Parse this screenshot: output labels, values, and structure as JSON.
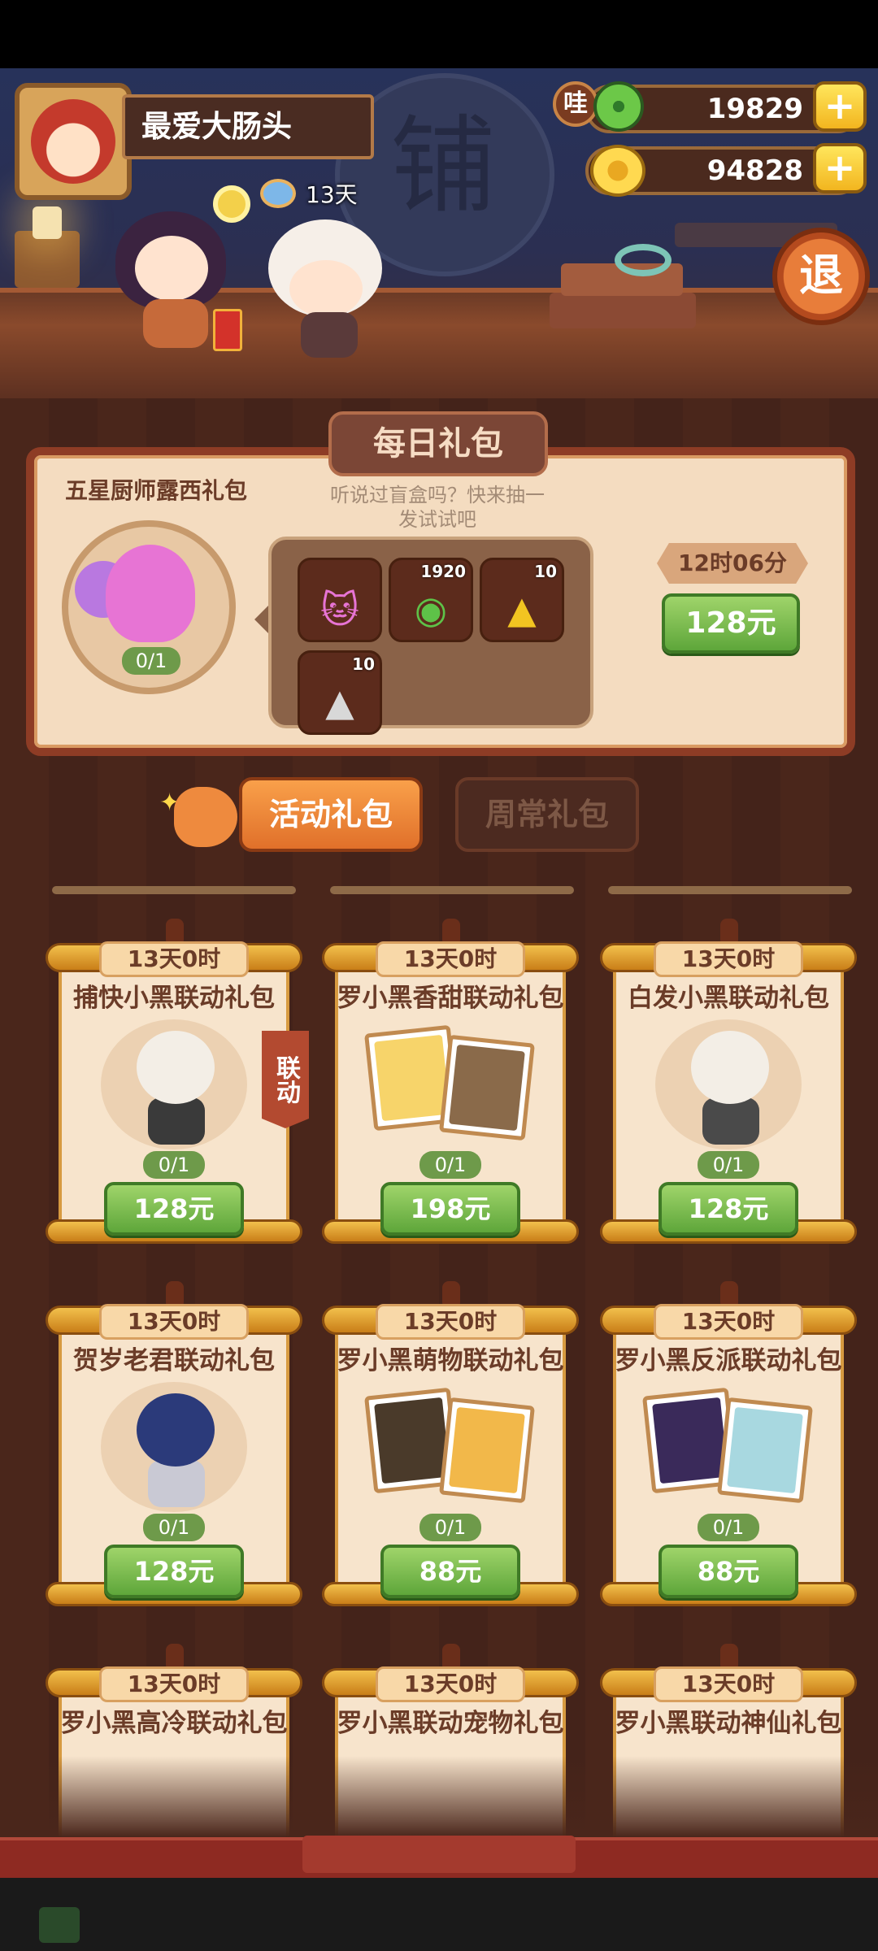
{
  "header": {
    "player_name": "最爱大肠头",
    "jade_amount": "19829",
    "coin_amount": "94828",
    "plus_label": "+",
    "wa_badge": "哇",
    "exit_label": "退",
    "days_left": "13天",
    "shop_sign": "铺"
  },
  "daily": {
    "title": "每日礼包",
    "pack_name": "五星厨师露西礼包",
    "hint": "听说过盲盒吗？快来抽一发试试吧",
    "count": "0/1",
    "timer": "12时06分",
    "price": "128元",
    "items": [
      {
        "icon": "pink-cat-icon",
        "num": ""
      },
      {
        "icon": "jade-coin-icon",
        "num": "1920"
      },
      {
        "icon": "gold-fragment-icon",
        "num": "10"
      },
      {
        "icon": "silver-fragment-icon",
        "num": "10"
      }
    ]
  },
  "tabs": {
    "active": "活动礼包",
    "inactive": "周常礼包"
  },
  "collab_tag": "联动",
  "cards": [
    {
      "time": "13天0时",
      "title": "捕快小黑联动礼包",
      "count": "0/1",
      "price": "128元"
    },
    {
      "time": "13天0时",
      "title": "罗小黑香甜联动礼包",
      "count": "0/1",
      "price": "198元"
    },
    {
      "time": "13天0时",
      "title": "白发小黑联动礼包",
      "count": "0/1",
      "price": "128元"
    },
    {
      "time": "13天0时",
      "title": "贺岁老君联动礼包",
      "count": "0/1",
      "price": "128元"
    },
    {
      "time": "13天0时",
      "title": "罗小黑萌物联动礼包",
      "count": "0/1",
      "price": "88元"
    },
    {
      "time": "13天0时",
      "title": "罗小黑反派联动礼包",
      "count": "0/1",
      "price": "88元"
    },
    {
      "time": "13天0时",
      "title": "罗小黑高冷联动礼包"
    },
    {
      "time": "13天0时",
      "title": "罗小黑联动宠物礼包"
    },
    {
      "time": "13天0时",
      "title": "罗小黑联动神仙礼包"
    }
  ],
  "colors": {
    "buy_green": "#6fb444",
    "panel_cream": "#f4dcc0",
    "frame_red": "#8e3c25",
    "tab_orange": "#f08a3a"
  }
}
